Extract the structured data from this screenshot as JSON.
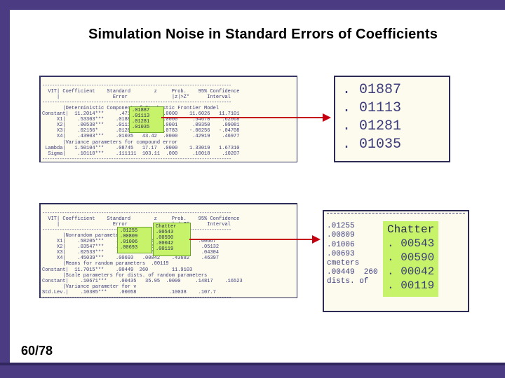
{
  "title": "Simulation Noise in Standard Errors of Coefficients",
  "slidenum": "60/78",
  "top_output": {
    "header": "  VIT| Coefficient    Standard        z     Prob.    95% Confidence",
    "header2": "     |                  Error               |z|>Z*      Interval",
    "section": "       |Deterministic Component of Stochastic Frontier Model",
    "rows": [
      "Constant|  11.2014***     .4714   23.82  .0000    11.6026   11.7101",
      "     X1|    .53303***    .01887   33.33  .0000     .54670    .62068",
      "     X2|    .00530***    .01113    3.25  .0001     .09350    .09081",
      "     X3|    .02156*      .01281    1.76  .0783    -.00256   -.04708",
      "     X4|    .43903***    .01035   43.42  .0000     .42919    .46977",
      "       |Variance parameters for compound error",
      " Lambda|   1.50104***    .08745   17.17  .0000    1.33019   1.67310",
      "  Sigma|    .10110***    .111111  103.11  .000     .10018    .10207"
    ],
    "highlight_values": [
      ".01887",
      ".01113",
      ".01281",
      ".01035"
    ]
  },
  "bottom_output": {
    "header": "  VIT| Coefficient    Standard        z     Prob.    95% Confidence",
    "header2": "     |                  Error               |z|>Z*      Interval",
    "section": "       |Nonrandom parameters",
    "rows": [
      "     X1|    .58205***    .01255  Chatter    .5574    .60667",
      "     X2|    .03547***    .00809   .00543    .01953    .05132",
      "     X3|    .02533***    .01006   .00590    .00355    .04304",
      "     X4|    .45039***    .00693   .00042    .43682    .46397",
      "       |Means for random parameters  .00119",
      "Constant|  11.7015***    .00449  260        11.9103",
      "       |Scale parameters for dists. of random parameters",
      "Constant|    .10671***    .00435   35.95  .0000     .14817    .16523",
      "       |Variance parameter for v",
      "Std.Lev.|    .10305***    .00058           .10038    .107.7"
    ],
    "highlight_left": [
      ".01255",
      ".00809",
      ".01006",
      ".00693"
    ],
    "highlight_right_label": "Chatter",
    "highlight_right": [
      ".00543",
      ".00590",
      ".00042",
      ".00119"
    ]
  },
  "mag1_values": [
    ". 01887",
    ". 01113",
    ". 01281",
    ". 01035"
  ],
  "mag2": {
    "left_slice": "\n.01255\n.00809\n.01006\n.00693\ncmeters\n.00449  260\ndists. of",
    "label": "Chatter",
    "values": [
      ". 00543",
      ". 00590",
      ". 00042",
      ". 00119"
    ]
  }
}
